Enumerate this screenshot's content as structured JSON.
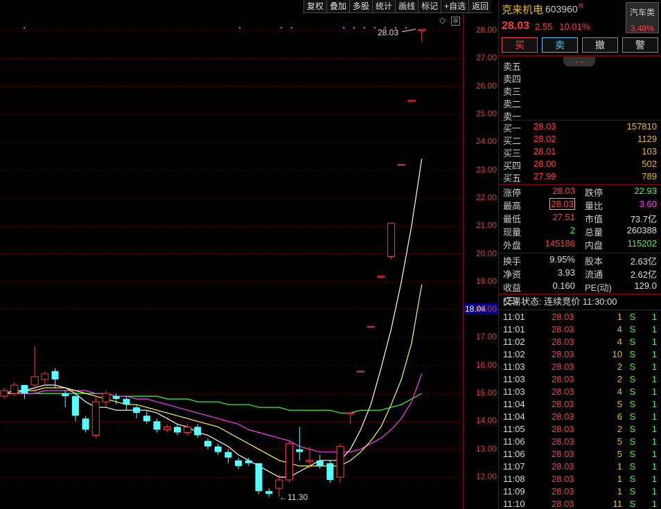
{
  "toolbar": [
    "复权",
    "叠加",
    "多股",
    "统计",
    "画线",
    "标记",
    "+自选",
    "返回"
  ],
  "chart": {
    "y_ticks": [
      "28.00",
      "27.00",
      "26.00",
      "25.00",
      "24.00",
      "23.00",
      "22.00",
      "21.00",
      "20.00",
      "19.00",
      "18.00",
      "17.00",
      "16.00",
      "15.00",
      "14.00",
      "13.00",
      "12.00"
    ],
    "price_marker": "18.04",
    "high_label": "28.03",
    "low_label": "11.30",
    "colors": {
      "up": "#ff3b3b",
      "down": "#54ffff",
      "ma5": "#ffffff",
      "ma10": "#ffff40",
      "ma20": "#ff40ff",
      "ma60": "#40ff40",
      "grid": "#8b0000"
    }
  },
  "chart_data": {
    "type": "candlestick",
    "ylim": [
      11.2,
      28.4
    ],
    "candles": [
      {
        "o": 14.9,
        "c": 15.1,
        "h": 15.2,
        "l": 14.8
      },
      {
        "o": 15.0,
        "c": 15.3,
        "h": 15.4,
        "l": 14.9
      },
      {
        "o": 15.3,
        "c": 15.0,
        "h": 15.3,
        "l": 14.8
      },
      {
        "o": 15.3,
        "c": 15.6,
        "h": 16.7,
        "l": 15.0
      },
      {
        "o": 15.5,
        "c": 15.7,
        "h": 15.8,
        "l": 15.3
      },
      {
        "o": 15.8,
        "c": 15.5,
        "h": 15.9,
        "l": 15.2
      },
      {
        "o": 15.0,
        "c": 14.9,
        "h": 15.1,
        "l": 14.5
      },
      {
        "o": 14.9,
        "c": 14.2,
        "h": 15.0,
        "l": 14.0
      },
      {
        "o": 14.1,
        "c": 13.7,
        "h": 14.2,
        "l": 13.6
      },
      {
        "o": 13.5,
        "c": 14.7,
        "h": 14.9,
        "l": 13.4
      },
      {
        "o": 14.7,
        "c": 15.0,
        "h": 15.1,
        "l": 14.5
      },
      {
        "o": 14.9,
        "c": 14.8,
        "h": 15.0,
        "l": 14.6
      },
      {
        "o": 14.8,
        "c": 14.6,
        "h": 14.9,
        "l": 14.4
      },
      {
        "o": 14.5,
        "c": 14.3,
        "h": 14.6,
        "l": 14.1
      },
      {
        "o": 14.2,
        "c": 14.0,
        "h": 14.4,
        "l": 13.9
      },
      {
        "o": 14.0,
        "c": 13.7,
        "h": 14.1,
        "l": 13.6
      },
      {
        "o": 13.7,
        "c": 13.8,
        "h": 13.9,
        "l": 13.6
      },
      {
        "o": 13.8,
        "c": 13.6,
        "h": 13.9,
        "l": 13.5
      },
      {
        "o": 13.6,
        "c": 13.8,
        "h": 13.9,
        "l": 13.5
      },
      {
        "o": 13.8,
        "c": 13.5,
        "h": 13.9,
        "l": 13.4
      },
      {
        "o": 13.3,
        "c": 13.1,
        "h": 13.4,
        "l": 13.0
      },
      {
        "o": 13.1,
        "c": 12.9,
        "h": 13.2,
        "l": 12.8
      },
      {
        "o": 12.9,
        "c": 12.7,
        "h": 13.0,
        "l": 12.5
      },
      {
        "o": 12.6,
        "c": 12.4,
        "h": 12.7,
        "l": 12.3
      },
      {
        "o": 12.6,
        "c": 12.5,
        "h": 12.7,
        "l": 12.4
      },
      {
        "o": 12.5,
        "c": 11.5,
        "h": 12.5,
        "l": 11.4
      },
      {
        "o": 11.5,
        "c": 11.4,
        "h": 11.6,
        "l": 11.3
      },
      {
        "o": 11.6,
        "c": 11.9,
        "h": 12.1,
        "l": 11.3
      },
      {
        "o": 11.9,
        "c": 13.2,
        "h": 13.3,
        "l": 11.8
      },
      {
        "o": 13.0,
        "c": 12.9,
        "h": 13.8,
        "l": 12.6
      },
      {
        "o": 12.6,
        "c": 12.6,
        "h": 13.1,
        "l": 12.3
      },
      {
        "o": 12.6,
        "c": 12.4,
        "h": 12.8,
        "l": 12.3
      },
      {
        "o": 12.5,
        "c": 11.9,
        "h": 12.6,
        "l": 11.8
      },
      {
        "o": 12.0,
        "c": 13.1,
        "h": 13.2,
        "l": 11.8
      },
      {
        "o": 14.3,
        "c": 14.3,
        "h": 14.3,
        "l": 13.9
      },
      {
        "o": 15.8,
        "c": 15.8,
        "h": 15.8,
        "l": 15.8
      },
      {
        "o": 17.4,
        "c": 17.4,
        "h": 17.4,
        "l": 17.4
      },
      {
        "o": 19.2,
        "c": 19.2,
        "h": 19.2,
        "l": 19.2
      },
      {
        "o": 19.9,
        "c": 21.1,
        "h": 21.1,
        "l": 19.8
      },
      {
        "o": 23.2,
        "c": 23.2,
        "h": 23.2,
        "l": 23.2
      },
      {
        "o": 25.5,
        "c": 25.5,
        "h": 25.5,
        "l": 25.5
      },
      {
        "o": 28.03,
        "c": 28.03,
        "h": 28.03,
        "l": 27.6
      }
    ],
    "ma5": [
      15.0,
      15.1,
      15.1,
      15.2,
      15.3,
      15.3,
      15.2,
      15.0,
      14.7,
      14.5,
      14.5,
      14.4,
      14.4,
      14.4,
      14.4,
      14.3,
      14.1,
      13.9,
      13.8,
      13.6,
      13.5,
      13.3,
      13.1,
      12.8,
      12.6,
      12.4,
      12.2,
      12.0,
      12.0,
      12.2,
      12.4,
      12.6,
      12.6,
      12.6,
      13.0,
      13.7,
      14.6,
      15.9,
      17.3,
      19.0,
      21.0,
      23.4
    ],
    "ma10": [
      15.0,
      15.0,
      15.1,
      15.1,
      15.2,
      15.2,
      15.2,
      15.1,
      15.0,
      14.9,
      14.8,
      14.7,
      14.6,
      14.6,
      14.5,
      14.4,
      14.3,
      14.2,
      14.1,
      14.0,
      13.9,
      13.8,
      13.6,
      13.4,
      13.2,
      13.0,
      12.8,
      12.6,
      12.5,
      12.4,
      12.4,
      12.4,
      12.4,
      12.4,
      12.6,
      12.9,
      13.3,
      13.8,
      14.6,
      15.5,
      16.8,
      18.9
    ],
    "ma20": [
      15.0,
      15.0,
      15.0,
      15.0,
      15.1,
      15.1,
      15.1,
      15.1,
      15.1,
      15.0,
      15.0,
      14.9,
      14.9,
      14.8,
      14.8,
      14.7,
      14.6,
      14.5,
      14.4,
      14.3,
      14.2,
      14.1,
      14.0,
      13.9,
      13.7,
      13.6,
      13.5,
      13.4,
      13.3,
      13.1,
      13.0,
      12.9,
      12.9,
      12.9,
      12.9,
      13.0,
      13.2,
      13.4,
      13.7,
      14.1,
      14.7,
      15.7
    ],
    "ma60": [
      15.0,
      15.0,
      15.0,
      15.0,
      15.0,
      15.0,
      15.0,
      15.0,
      15.0,
      15.0,
      15.0,
      14.9,
      14.9,
      14.9,
      14.9,
      14.9,
      14.8,
      14.8,
      14.8,
      14.7,
      14.7,
      14.7,
      14.6,
      14.6,
      14.6,
      14.5,
      14.5,
      14.5,
      14.4,
      14.4,
      14.4,
      14.4,
      14.4,
      14.3,
      14.3,
      14.4,
      14.4,
      14.4,
      14.5,
      14.6,
      14.8,
      15.0
    ]
  },
  "stock": {
    "name": "克来机电",
    "code": "603960",
    "flag": "R",
    "sector": "汽车类",
    "sector_change": "3.48%",
    "price": "28.03",
    "change": "2.55",
    "change_pct": "10.01%"
  },
  "actions": [
    "买",
    "卖",
    "撤",
    "警"
  ],
  "asks": [
    {
      "label": "卖五",
      "price": "",
      "vol": ""
    },
    {
      "label": "卖四",
      "price": "",
      "vol": ""
    },
    {
      "label": "卖三",
      "price": "",
      "vol": ""
    },
    {
      "label": "卖二",
      "price": "",
      "vol": ""
    },
    {
      "label": "卖一",
      "price": "",
      "vol": ""
    }
  ],
  "bids": [
    {
      "label": "买一",
      "price": "28.03",
      "vol": "157810"
    },
    {
      "label": "买二",
      "price": "28.02",
      "vol": "1129"
    },
    {
      "label": "买三",
      "price": "28.01",
      "vol": "103"
    },
    {
      "label": "买四",
      "price": "28.00",
      "vol": "502"
    },
    {
      "label": "买五",
      "price": "27.99",
      "vol": "789"
    }
  ],
  "stats1": [
    {
      "l": "涨停",
      "v": "28.03",
      "vc": "red",
      "l2": "跌停",
      "v2": "22.93",
      "v2c": "green"
    },
    {
      "l": "最高",
      "v": "28.03",
      "vc": "red",
      "l2": "量比",
      "v2": "3.60",
      "v2c": "mag",
      "box": true
    },
    {
      "l": "最低",
      "v": "27.51",
      "vc": "red",
      "l2": "市值",
      "v2": "73.7亿",
      "v2c": "white"
    },
    {
      "l": "现量",
      "v": "2",
      "vc": "green",
      "l2": "总量",
      "v2": "260388",
      "v2c": "white"
    },
    {
      "l": "外盘",
      "v": "145186",
      "vc": "red",
      "l2": "内盘",
      "v2": "115202",
      "v2c": "green"
    }
  ],
  "stats2": [
    {
      "l": "换手",
      "v": "9.95%",
      "vc": "white",
      "l2": "股本",
      "v2": "2.63亿",
      "v2c": "white"
    },
    {
      "l": "净资",
      "v": "3.93",
      "vc": "white",
      "l2": "流通",
      "v2": "2.62亿",
      "v2c": "white"
    },
    {
      "l": "收益(三)",
      "v": "0.160",
      "vc": "white",
      "l2": "PE(动)",
      "v2": "129.0",
      "v2c": "white"
    }
  ],
  "trade_status": "交易状态: 连续竞价 11:30:00",
  "ticks": [
    {
      "t": "11:01",
      "p": "28.03",
      "vol": "1",
      "s": "S",
      "n": "1"
    },
    {
      "t": "11:01",
      "p": "28.03",
      "vol": "4",
      "s": "S",
      "n": "1"
    },
    {
      "t": "11:02",
      "p": "28.03",
      "vol": "4",
      "s": "S",
      "n": "1"
    },
    {
      "t": "11:02",
      "p": "28.03",
      "vol": "10",
      "s": "S",
      "n": "1"
    },
    {
      "t": "11:03",
      "p": "28.03",
      "vol": "2",
      "s": "S",
      "n": "1"
    },
    {
      "t": "11:03",
      "p": "28.03",
      "vol": "2",
      "s": "S",
      "n": "1"
    },
    {
      "t": "11:03",
      "p": "28.03",
      "vol": "4",
      "s": "S",
      "n": "1"
    },
    {
      "t": "11:04",
      "p": "28.03",
      "vol": "5",
      "s": "S",
      "n": "1"
    },
    {
      "t": "11:04",
      "p": "28.03",
      "vol": "6",
      "s": "S",
      "n": "1"
    },
    {
      "t": "11:05",
      "p": "28.03",
      "vol": "2",
      "s": "S",
      "n": "1"
    },
    {
      "t": "11:06",
      "p": "28.03",
      "vol": "5",
      "s": "S",
      "n": "1"
    },
    {
      "t": "11:06",
      "p": "28.03",
      "vol": "5",
      "s": "S",
      "n": "1"
    },
    {
      "t": "11:07",
      "p": "28.03",
      "vol": "1",
      "s": "S",
      "n": "1"
    },
    {
      "t": "11:08",
      "p": "28.03",
      "vol": "1",
      "s": "S",
      "n": "1"
    },
    {
      "t": "11:09",
      "p": "28.03",
      "vol": "1",
      "s": "S",
      "n": "1"
    },
    {
      "t": "11:10",
      "p": "28.03",
      "vol": "11",
      "s": "S",
      "n": "1"
    }
  ]
}
